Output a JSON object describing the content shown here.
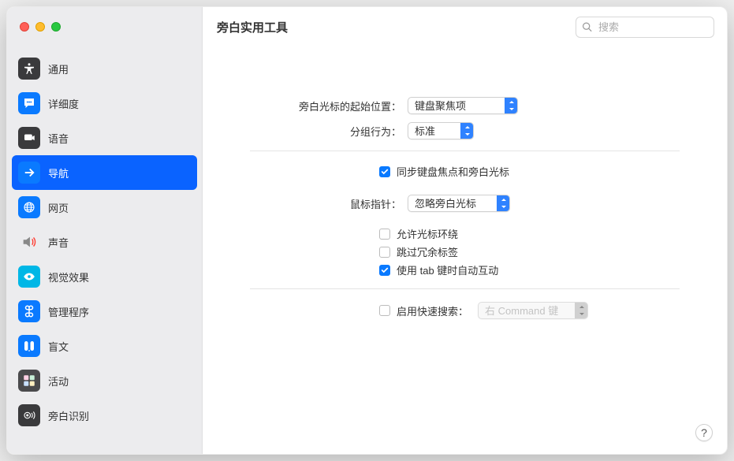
{
  "window": {
    "title": "旁白实用工具"
  },
  "search": {
    "placeholder": "搜索"
  },
  "sidebar": {
    "items": [
      {
        "label": "通用",
        "icon": "universal-icon",
        "bg": "#3a3a3c",
        "fg": "#ffffff"
      },
      {
        "label": "详细度",
        "icon": "message-icon",
        "bg": "#0a7aff",
        "fg": "#ffffff"
      },
      {
        "label": "语音",
        "icon": "speech-icon",
        "bg": "#3a3a3c",
        "fg": "#ffffff"
      },
      {
        "label": "导航",
        "icon": "arrow-icon",
        "bg": "#0a7aff",
        "fg": "#ffffff",
        "selected": true
      },
      {
        "label": "网页",
        "icon": "globe-icon",
        "bg": "#0a7aff",
        "fg": "#ffffff"
      },
      {
        "label": "声音",
        "icon": "speaker-icon",
        "bg": "transparent",
        "fg": "#555"
      },
      {
        "label": "视觉效果",
        "icon": "eye-icon",
        "bg": "#00b7e6",
        "fg": "#ffffff"
      },
      {
        "label": "管理程序",
        "icon": "command-icon",
        "bg": "#0a7aff",
        "fg": "#ffffff"
      },
      {
        "label": "盲文",
        "icon": "braille-icon",
        "bg": "#0a7aff",
        "fg": "#ffffff"
      },
      {
        "label": "活动",
        "icon": "activity-icon",
        "bg": "#4a4a4c",
        "fg": "#ffc8e0"
      },
      {
        "label": "旁白识别",
        "icon": "recognition-icon",
        "bg": "#3a3a3c",
        "fg": "#ffffff"
      }
    ]
  },
  "settings": {
    "cursor_start_label": "旁白光标的起始位置：",
    "cursor_start_value": "键盘聚焦项",
    "grouping_label": "分组行为：",
    "grouping_value": "标准",
    "sync_keyboard": {
      "label": "同步键盘焦点和旁白光标",
      "checked": true
    },
    "mouse_pointer_label": "鼠标指针：",
    "mouse_pointer_value": "忽略旁白光标",
    "allow_wrap": {
      "label": "允许光标环绕",
      "checked": false
    },
    "skip_redundant": {
      "label": "跳过冗余标签",
      "checked": false
    },
    "tab_auto": {
      "label": "使用 tab 键时自动互动",
      "checked": true
    },
    "quick_search": {
      "label": "启用快速搜索：",
      "checked": false
    },
    "quick_search_value": "右 Command 键"
  },
  "help": {
    "label": "?"
  }
}
